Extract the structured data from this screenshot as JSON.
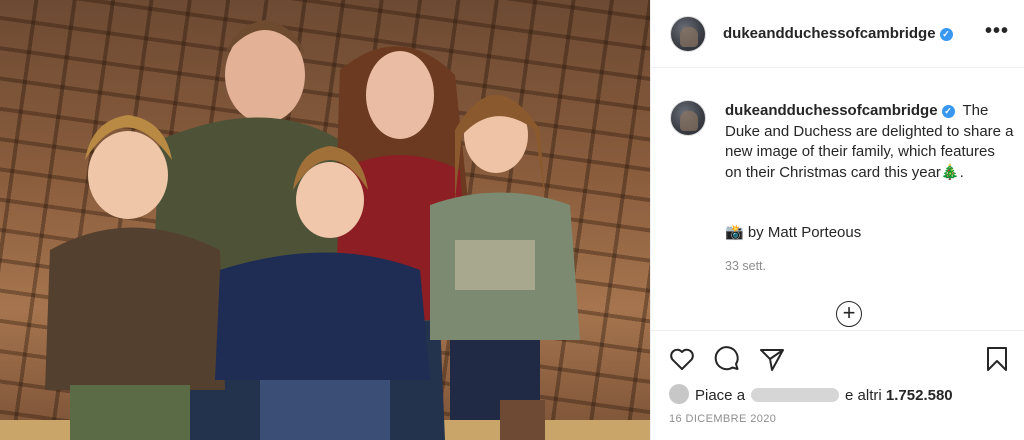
{
  "post": {
    "username": "dukeandduchessofcambridge",
    "verified_symbol": "✓",
    "more_symbol": "•••",
    "caption_text": "The Duke and Duchess are delighted to share a new image of their family, which features on their Christmas card this year🎄.",
    "photo_credit": "📸 by Matt Porteous",
    "age": "33 sett.",
    "load_more_symbol": "+"
  },
  "likes": {
    "prefix": "Piace a",
    "suffix": "e altri",
    "count": "1.752.580"
  },
  "date": "16 DICEMBRE 2020",
  "colors": {
    "verified": "#3897f0",
    "text": "#262626",
    "muted": "#8e8e8e",
    "divider": "#efefef"
  },
  "icons": [
    "heart-icon",
    "comment-icon",
    "share-icon",
    "bookmark-icon",
    "plus-circle-icon",
    "more-icon",
    "verified-badge-icon"
  ]
}
